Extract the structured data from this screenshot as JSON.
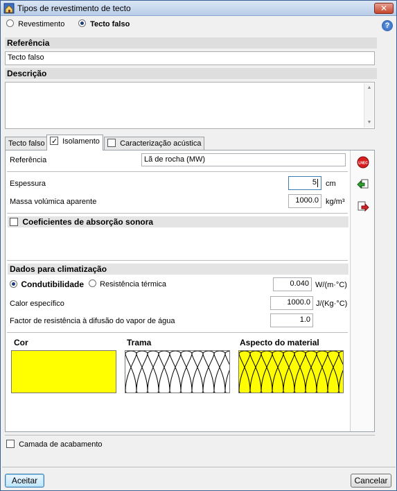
{
  "window": {
    "title": "Tipos de revestimento de tecto",
    "close_label": "✕"
  },
  "type_selector": {
    "options": [
      {
        "label": "Revestimento",
        "selected": false
      },
      {
        "label": "Tecto falso",
        "selected": true
      }
    ]
  },
  "referencia": {
    "label": "Referência",
    "value": "Tecto falso"
  },
  "descricao": {
    "label": "Descrição",
    "value": ""
  },
  "tabs": [
    {
      "label": "Tecto falso",
      "active": false,
      "has_checkbox": false
    },
    {
      "label": "Isolamento",
      "active": true,
      "has_checkbox": true,
      "checked": true
    },
    {
      "label": "Caracterização acústica",
      "active": false,
      "has_checkbox": true,
      "checked": false
    }
  ],
  "isolamento": {
    "referencia_label": "Referência",
    "referencia_value": "Lã de rocha (MW)",
    "espessura_label": "Espessura",
    "espessura_value": "5",
    "espessura_unit": "cm",
    "massa_label": "Massa volúmica aparente",
    "massa_value": "1000.0",
    "massa_unit": "kg/m³",
    "coef_label": "Coeficientes de absorção sonora",
    "coef_checked": false,
    "clima_heading": "Dados para climatização",
    "condutibilidade_label": "Condutibilidade",
    "resistencia_label": "Resistência térmica",
    "condutibilidade_value": "0.040",
    "condutibilidade_unit": "W/(m·°C)",
    "calor_label": "Calor específico",
    "calor_value": "1000.0",
    "calor_unit": "J/(Kg·°C)",
    "factor_label": "Factor de resistência à difusão do vapor de água",
    "factor_value": "1.0",
    "cor_label": "Cor",
    "trama_label": "Trama",
    "aspecto_label": "Aspecto do material"
  },
  "colors": {
    "material": "#ffff00",
    "hatch": "#000000"
  },
  "sidebar_icons": [
    "lned-icon",
    "import-icon",
    "export-icon"
  ],
  "camada": {
    "label": "Camada de acabamento",
    "checked": false
  },
  "buttons": {
    "ok": "Aceitar",
    "cancel": "Cancelar"
  },
  "help_label": "?"
}
